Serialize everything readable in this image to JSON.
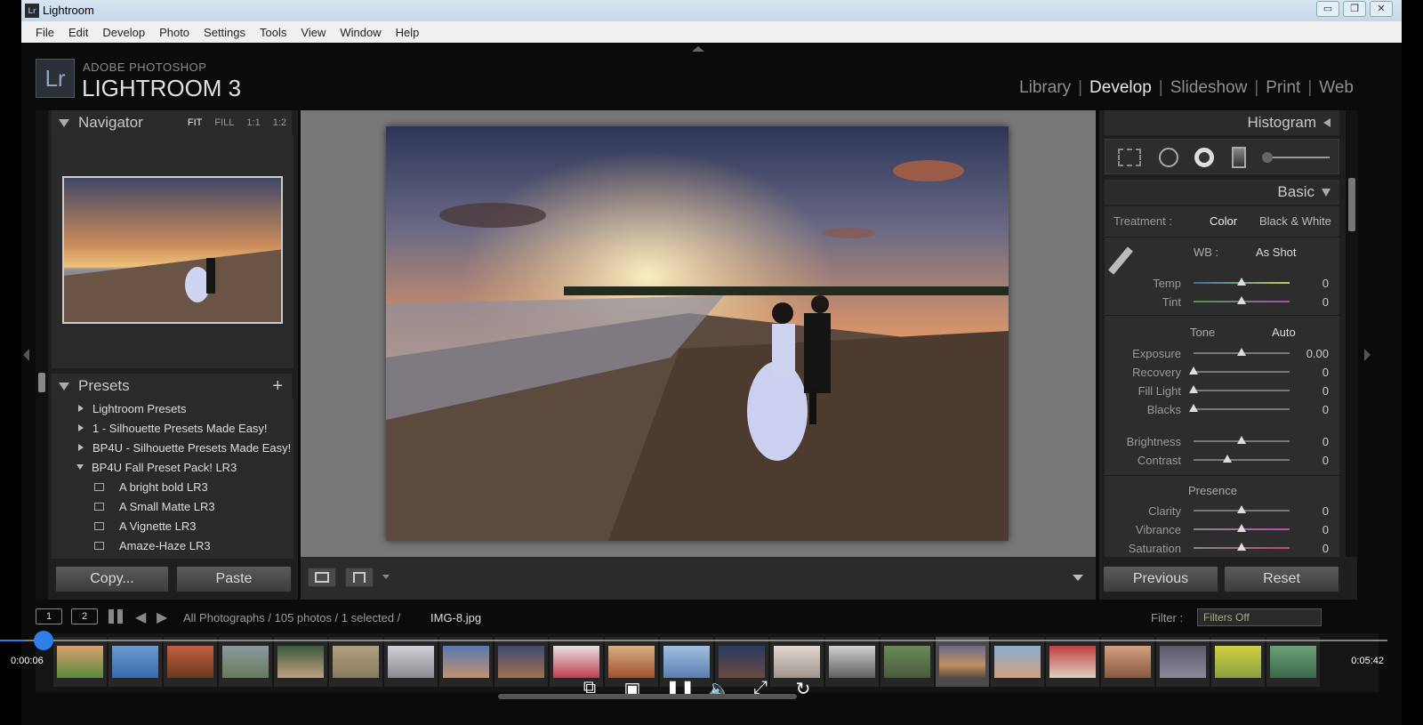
{
  "titlebar": {
    "title": "Lightroom",
    "min": "▭",
    "restore": "❐",
    "close": "✕"
  },
  "menu": [
    "File",
    "Edit",
    "Develop",
    "Photo",
    "Settings",
    "Tools",
    "View",
    "Window",
    "Help"
  ],
  "header": {
    "logo_mark": "Lr",
    "logo_sub": "ADOBE PHOTOSHOP",
    "logo_main": "LIGHTROOM 3",
    "modules": [
      "Library",
      "Develop",
      "Slideshow",
      "Print",
      "Web"
    ],
    "active_module": "Develop"
  },
  "navigator": {
    "title": "Navigator",
    "opts": [
      "FIT",
      "FILL",
      "1:1",
      "1:2"
    ],
    "selected": "FIT"
  },
  "presets": {
    "title": "Presets",
    "add": "+",
    "items": [
      {
        "label": "Lightroom Presets",
        "kind": "folder",
        "open": false
      },
      {
        "label": "1 - Silhouette Presets Made Easy!",
        "kind": "folder",
        "open": false
      },
      {
        "label": "BP4U - Silhouette Presets Made Easy!",
        "kind": "folder",
        "open": false
      },
      {
        "label": "BP4U Fall Preset Pack! LR3",
        "kind": "folder",
        "open": true
      },
      {
        "label": "A bright bold LR3",
        "kind": "preset"
      },
      {
        "label": "A Small Matte LR3",
        "kind": "preset"
      },
      {
        "label": "A Vignette LR3",
        "kind": "preset"
      },
      {
        "label": "Amaze-Haze LR3",
        "kind": "preset"
      }
    ]
  },
  "left_buttons": {
    "copy": "Copy...",
    "paste": "Paste"
  },
  "right": {
    "histogram": "Histogram",
    "basic": "Basic",
    "treatment_label": "Treatment :",
    "treatment_color": "Color",
    "treatment_bw": "Black & White",
    "wb_label": "WB :",
    "wb_value": "As Shot",
    "tone": "Tone",
    "auto": "Auto",
    "presence": "Presence",
    "sliders": [
      {
        "name": "temp",
        "label": "Temp",
        "value": "0",
        "level": 0.5
      },
      {
        "name": "tint",
        "label": "Tint",
        "value": "0",
        "level": 0.5
      },
      {
        "name": "exposure",
        "label": "Exposure",
        "value": "0.00",
        "level": 0.5
      },
      {
        "name": "recovery",
        "label": "Recovery",
        "value": "0",
        "level": 0
      },
      {
        "name": "fill-light",
        "label": "Fill Light",
        "value": "0",
        "level": 0
      },
      {
        "name": "blacks",
        "label": "Blacks",
        "value": "0",
        "level": 0
      },
      {
        "name": "brightness",
        "label": "Brightness",
        "value": "0",
        "level": 0.5
      },
      {
        "name": "contrast",
        "label": "Contrast",
        "value": "0",
        "level": 0.35
      },
      {
        "name": "clarity",
        "label": "Clarity",
        "value": "0",
        "level": 0.5
      },
      {
        "name": "vibrance",
        "label": "Vibrance",
        "value": "0",
        "level": 0.5
      },
      {
        "name": "saturation",
        "label": "Saturation",
        "value": "0",
        "level": 0.5
      }
    ],
    "previous": "Previous",
    "reset": "Reset"
  },
  "stripbar": {
    "page1": "1",
    "page2": "2",
    "source": "All Photographs / 105 photos / 1 selected /",
    "filename": "IMG-8.jpg",
    "filter_label": "Filter :",
    "filter_value": "Filters Off"
  },
  "player": {
    "current": "0:00:06",
    "total": "0:05:42",
    "progress": 0.018
  }
}
